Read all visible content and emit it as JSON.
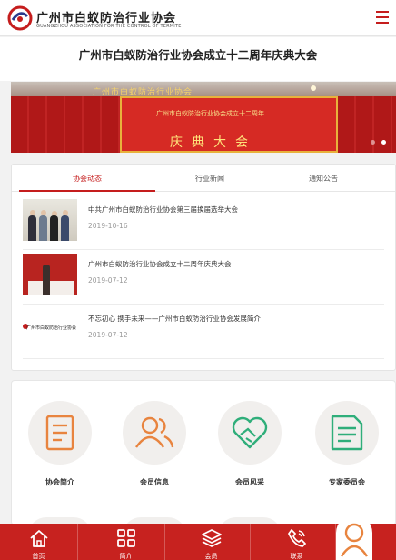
{
  "header": {
    "logo_cn": "广州市白蚁防治行业协会",
    "logo_en": "GUANGZHOU ASSOCIATION FOR THE CONTROL OF TERMITE"
  },
  "page_title": "广州市白蚁防治行业协会成立十二周年庆典大会",
  "banner": {
    "top_text": "广州市白蚁防治行业协会",
    "mid_text": "广州市白蚁防治行业协会成立十二周年",
    "big_text": "庆典大会"
  },
  "tabs": [
    {
      "label": "协会动态"
    },
    {
      "label": "行业新闻"
    },
    {
      "label": "通知公告"
    }
  ],
  "news": [
    {
      "title": "中共广州市白蚁防治行业协会第三届换届选举大会",
      "date": "2019-10-16"
    },
    {
      "title": "广州市白蚁防治行业协会成立十二周年庆典大会",
      "date": "2019-07-12"
    },
    {
      "title": "不忘初心 携手未来——广州市白蚁防治行业协会发展简介",
      "date": "2019-07-12"
    }
  ],
  "functions": [
    {
      "label": "协会简介",
      "icon": "document-icon"
    },
    {
      "label": "会员信息",
      "icon": "members-icon"
    },
    {
      "label": "会员风采",
      "icon": "handshake-heart-icon"
    },
    {
      "label": "专家委员会",
      "icon": "expert-document-icon"
    }
  ],
  "bottom_nav": [
    {
      "label": "首页",
      "icon": "home-icon"
    },
    {
      "label": "简介",
      "icon": "grid-icon"
    },
    {
      "label": "会员",
      "icon": "layers-icon"
    },
    {
      "label": "联系",
      "icon": "phone-icon"
    }
  ],
  "thumb_logo_text": "广州市白蚁防治行业协会",
  "colors": {
    "brand_red": "#c51d1d",
    "nav_red": "#c7221f",
    "icon_orange": "#e8843f",
    "icon_green": "#2fae7a"
  }
}
